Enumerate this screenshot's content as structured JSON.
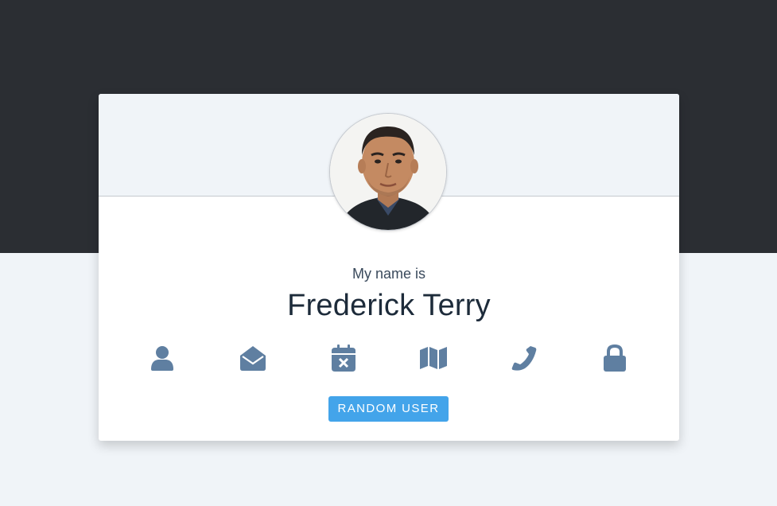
{
  "profile": {
    "intro_label": "My name is",
    "name": "Frederick Terry"
  },
  "icons": [
    {
      "name": "user-icon",
      "meaning": "name"
    },
    {
      "name": "envelope-open-icon",
      "meaning": "email"
    },
    {
      "name": "calendar-times-icon",
      "meaning": "birthday"
    },
    {
      "name": "map-icon",
      "meaning": "location"
    },
    {
      "name": "phone-icon",
      "meaning": "phone"
    },
    {
      "name": "lock-icon",
      "meaning": "password"
    }
  ],
  "actions": {
    "random_user_label": "RANDOM USER"
  },
  "colors": {
    "top_band": "#2b2e33",
    "page_background": "#f0f4f8",
    "icon": "#5f7fa1",
    "button": "#43a4ea",
    "name_text": "#1d2b3a"
  }
}
